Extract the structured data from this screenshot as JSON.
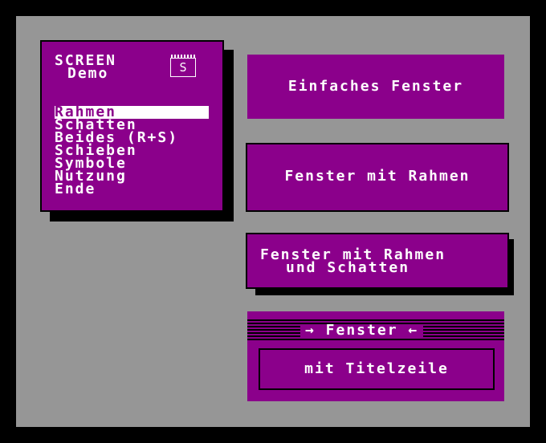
{
  "menu": {
    "title": "SCREEN",
    "subtitle": "Demo",
    "logo_glyph": "S",
    "items": [
      {
        "label": "Rahmen",
        "selected": true
      },
      {
        "label": "Schatten",
        "selected": false
      },
      {
        "label": "Beides (R+S)",
        "selected": false
      },
      {
        "label": "Schieben",
        "selected": false
      },
      {
        "label": "Symbole",
        "selected": false
      },
      {
        "label": "Nutzung",
        "selected": false
      },
      {
        "label": "Ende",
        "selected": false
      }
    ]
  },
  "windows": {
    "simple": "Einfaches Fenster",
    "framed": "Fenster mit Rahmen",
    "framed_shadow_line1": "Fenster mit Rahmen",
    "framed_shadow_line2": "und Schatten",
    "titled_title": "→ Fenster ←",
    "titled_body": "mit Titelzeile"
  },
  "colors": {
    "background": "#969696",
    "window": "#8b008b",
    "text": "#ffffff",
    "border": "#000000"
  }
}
